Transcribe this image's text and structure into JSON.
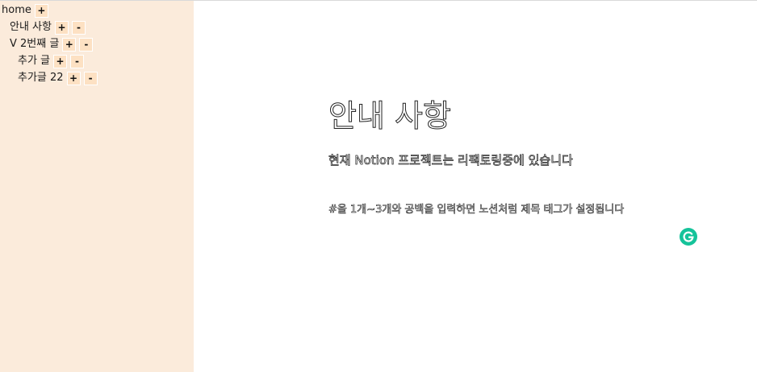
{
  "sidebar": {
    "add_label": "+",
    "remove_label": "-",
    "items": [
      {
        "label": "home"
      },
      {
        "label": "안내 사항"
      },
      {
        "label": "V 2번째 글"
      },
      {
        "label": "추가 글"
      },
      {
        "label": "추가글 22"
      }
    ]
  },
  "document": {
    "title": "안내 사항",
    "body": "현재 Notion 프로젝트는 리팩토링중에 있습니다",
    "tip": "#을 1개~3개와 공백을 입력하면 노션처럼 제목 태그가 설정됩니다"
  },
  "extension": {
    "icon": "grammarly-icon",
    "color": "#15c39a"
  },
  "colors": {
    "sidebar_bg": "#fbebdb",
    "button_bg": "#fde1c3"
  }
}
